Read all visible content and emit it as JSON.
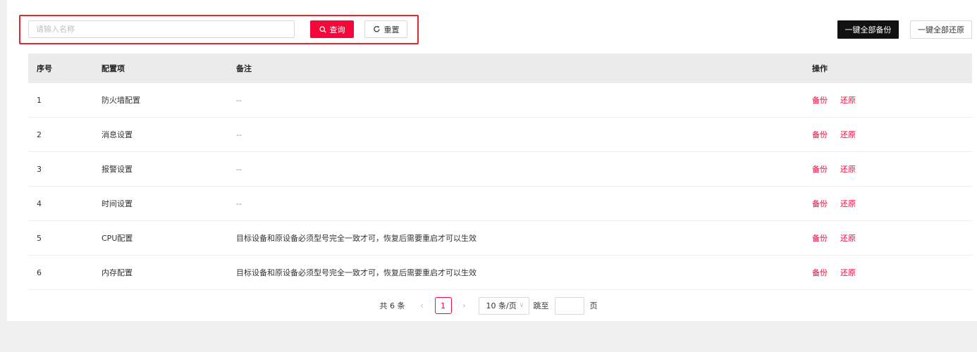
{
  "toolbar": {
    "search_placeholder": "请输入名称",
    "query_label": "查询",
    "reset_label": "重置",
    "backup_all_label": "一键全部备份",
    "restore_all_label": "一键全部还原"
  },
  "table": {
    "headers": {
      "index": "序号",
      "name": "配置项",
      "note": "备注",
      "op": "操作"
    },
    "rows": [
      {
        "index": "1",
        "name": "防火墙配置",
        "note": "--",
        "backup": "备份",
        "restore": "还原"
      },
      {
        "index": "2",
        "name": "消息设置",
        "note": "--",
        "backup": "备份",
        "restore": "还原"
      },
      {
        "index": "3",
        "name": "报警设置",
        "note": "--",
        "backup": "备份",
        "restore": "还原"
      },
      {
        "index": "4",
        "name": "时间设置",
        "note": "--",
        "backup": "备份",
        "restore": "还原"
      },
      {
        "index": "5",
        "name": "CPU配置",
        "note": "目标设备和原设备必须型号完全一致才可，恢复后需要重启才可以生效",
        "backup": "备份",
        "restore": "还原"
      },
      {
        "index": "6",
        "name": "内存配置",
        "note": "目标设备和原设备必须型号完全一致才可，恢复后需要重启才可以生效",
        "backup": "备份",
        "restore": "还原"
      }
    ]
  },
  "pagination": {
    "total": "共 6 条",
    "current_page": "1",
    "page_size": "10 条/页",
    "jump_label": "跳至",
    "page_label": "页"
  },
  "colors": {
    "accent": "#f5073b",
    "highlight_border": "#e8232c",
    "dark_button": "#111111"
  }
}
